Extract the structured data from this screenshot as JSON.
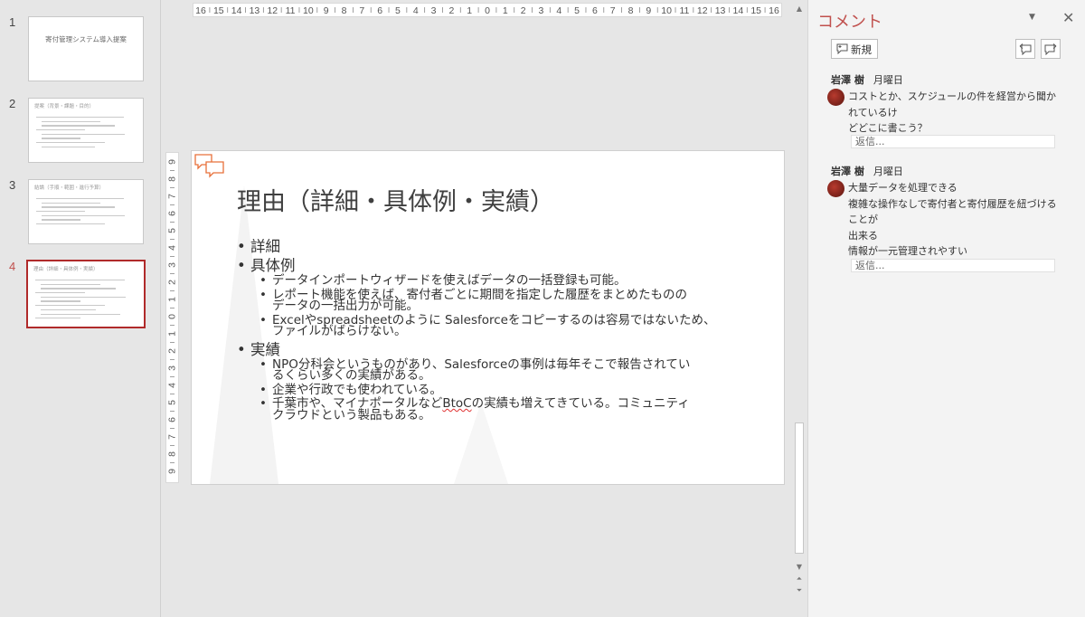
{
  "thumbnails": [
    {
      "num": "1",
      "title": "寄付管理システム導入提案",
      "lines": 0,
      "type": "title"
    },
    {
      "num": "2",
      "title": "提案（背景・課題・目的）",
      "lines": 8,
      "type": "content"
    },
    {
      "num": "3",
      "title": "結論（手順・範囲・進行予算）",
      "lines": 7,
      "type": "content"
    },
    {
      "num": "4",
      "title": "理由（詳細・具体例・実績）",
      "lines": 10,
      "type": "content",
      "active": true
    }
  ],
  "rulers": {
    "horizontal_labels": [
      "16",
      "15",
      "14",
      "13",
      "12",
      "11",
      "10",
      "9",
      "8",
      "7",
      "6",
      "5",
      "4",
      "3",
      "2",
      "1",
      "0",
      "1",
      "2",
      "3",
      "4",
      "5",
      "6",
      "7",
      "8",
      "9",
      "10",
      "11",
      "12",
      "13",
      "14",
      "15",
      "16"
    ],
    "vertical_labels": [
      "9",
      "8",
      "7",
      "6",
      "5",
      "4",
      "3",
      "2",
      "1",
      "0",
      "1",
      "2",
      "3",
      "4",
      "5",
      "6",
      "7",
      "8",
      "9"
    ]
  },
  "slide": {
    "title": "理由（詳細・具体例・実績）",
    "bullets": [
      {
        "text": "詳細",
        "subs": []
      },
      {
        "text": "具体例",
        "subs": [
          {
            "lines": [
              "データインポートウィザードを使えばデータの一括登録も可能。"
            ]
          },
          {
            "lines": [
              "レポート機能を使えば、寄付者ごとに期間を指定した履歴をまとめたものの",
              "データの一括出力が可能。"
            ]
          },
          {
            "lines": [
              "Excelやspreadsheetのように Salesforceをコピーするのは容易ではないため、",
              "ファイルがばらけない。"
            ]
          }
        ]
      },
      {
        "text": "実績",
        "subs": [
          {
            "lines": [
              "NPO分科会というものがあり、Salesforceの事例は毎年そこで報告されてい",
              "るくらい多くの実績がある。"
            ]
          },
          {
            "lines": [
              "企業や行政でも使われている。"
            ]
          },
          {
            "lines": [
              "千葉市や、マイナポータルなど",
              "BtoC",
              "の実績も増えてきている。コミュニティ",
              "クラウドという製品もある。"
            ],
            "squiggle_index": 1
          }
        ]
      }
    ]
  },
  "comments_pane": {
    "title": "コメント",
    "new_label": "新規",
    "threads": [
      {
        "author": "岩澤 樹",
        "date": "月曜日",
        "lines": [
          "コストとか、スケジュールの件を経営から聞かれているけ",
          "どどこに書こう？"
        ],
        "reply_placeholder": "返信..."
      },
      {
        "author": "岩澤 樹",
        "date": "月曜日",
        "lines": [
          "大量データを処理できる",
          "複雑な操作なしで寄付者と寄付履歴を紐づけることが",
          "出来る",
          "情報が一元管理されやすい"
        ],
        "reply_placeholder": "返信..."
      }
    ]
  }
}
